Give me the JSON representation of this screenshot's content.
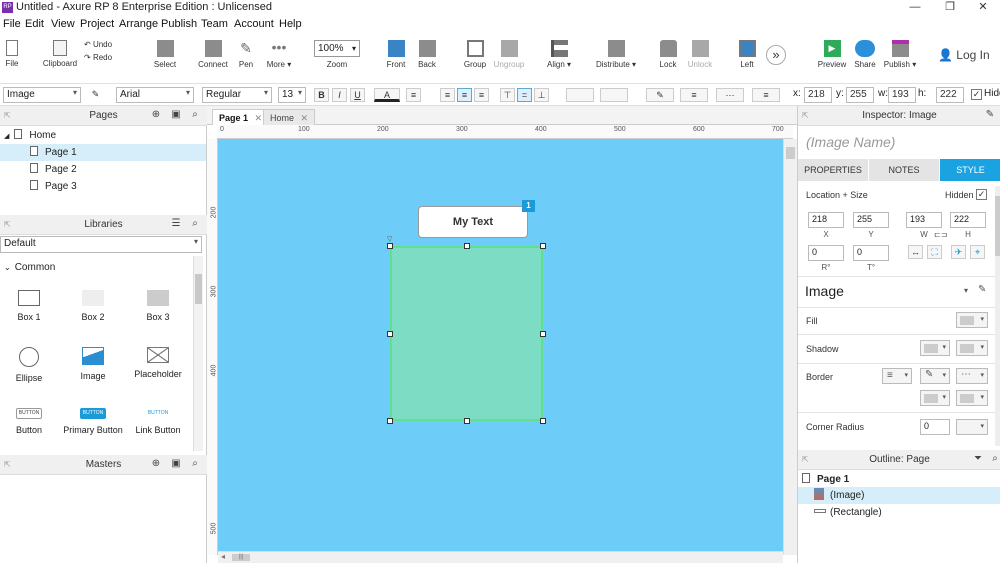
{
  "window": {
    "title": "Untitled - Axure RP 8 Enterprise Edition : Unlicensed",
    "app_icon": "RP",
    "minimize": "—",
    "maximize": "❐",
    "close": "✕"
  },
  "menu": [
    "File",
    "Edit",
    "View",
    "Project",
    "Arrange",
    "Publish",
    "Team",
    "Account",
    "Help"
  ],
  "toolbar": {
    "file": "File",
    "clipboard": "Clipboard",
    "undo": "Undo",
    "redo": "Redo",
    "select": "Select",
    "connect": "Connect",
    "pen": "Pen",
    "more": "More ▾",
    "zoom_value": "100%",
    "zoom": "Zoom",
    "front": "Front",
    "back": "Back",
    "group": "Group",
    "ungroup": "Ungroup",
    "align": "Align ▾",
    "distribute": "Distribute ▾",
    "lock": "Lock",
    "unlock": "Unlock",
    "left": "Left",
    "preview": "Preview",
    "share": "Share",
    "publish": "Publish ▾",
    "login": "Log In",
    "overflow": "»"
  },
  "format": {
    "widget_type": "Image",
    "font": "Arial",
    "weight": "Regular",
    "size": "13",
    "bold": "B",
    "italic": "I",
    "underline": "U",
    "text_color": "A",
    "x_label": "x:",
    "x": "218",
    "y_label": "y:",
    "y": "255",
    "w_label": "w:",
    "w": "193",
    "h_label": "h:",
    "h": "222",
    "hidden_label": "Hidd"
  },
  "pages_panel": {
    "title": "Pages",
    "items": [
      {
        "label": "Home"
      },
      {
        "label": "Page 1"
      },
      {
        "label": "Page 2"
      },
      {
        "label": "Page 3"
      }
    ]
  },
  "libraries_panel": {
    "title": "Libraries",
    "selected": "Default",
    "group": "Common",
    "items": [
      "Box 1",
      "Box 2",
      "Box 3",
      "Ellipse",
      "Image",
      "Placeholder",
      "Button",
      "Primary Button",
      "Link Button"
    ],
    "button_caption": "BUTTON"
  },
  "masters_panel": {
    "title": "Masters"
  },
  "canvas": {
    "tabs": [
      "Page 1",
      "Home"
    ],
    "tab_close": "✕",
    "ruler_h": [
      "0",
      "100",
      "200",
      "300",
      "400",
      "500",
      "600",
      "700"
    ],
    "ruler_v": [
      "200",
      "300",
      "400",
      "500"
    ],
    "widget_text": "My Text",
    "badge": "1",
    "scroll_left": "◂",
    "scroll_grip": "|||",
    "background": "#6ecdf8"
  },
  "inspector": {
    "title": "Inspector: Image",
    "name_placeholder": "(Image Name)",
    "tabs": [
      "PROPERTIES",
      "NOTES",
      "STYLE"
    ],
    "location_size": "Location + Size",
    "hidden": "Hidden",
    "x": "218",
    "y": "255",
    "w": "193",
    "h": "222",
    "x_lbl": "X",
    "y_lbl": "Y",
    "w_lbl": "W",
    "h_lbl": "H",
    "rot1": "0",
    "rot2": "0",
    "rot1_lbl": "R°",
    "rot2_lbl": "T°",
    "style_name": "Image",
    "fill": "Fill",
    "shadow": "Shadow",
    "border": "Border",
    "corner_radius": "Corner Radius",
    "corner_value": "0"
  },
  "outline": {
    "title": "Outline: Page",
    "page": "Page 1",
    "items": [
      "(Image)",
      "(Rectangle)"
    ]
  }
}
